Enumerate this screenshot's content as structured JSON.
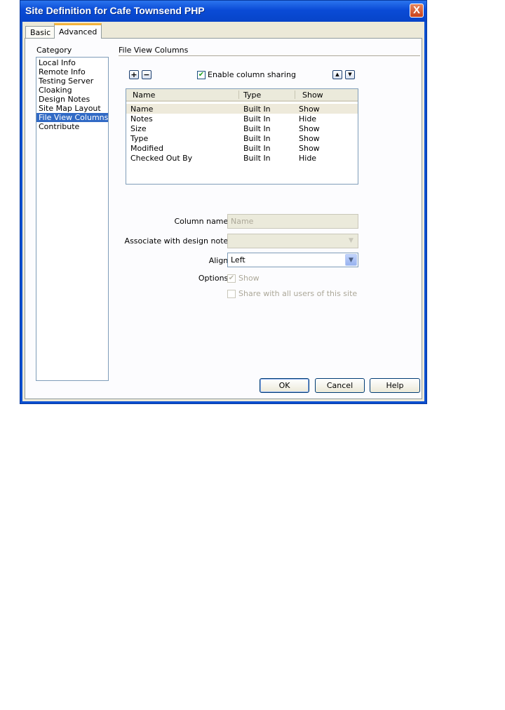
{
  "window": {
    "title": "Site Definition for Cafe Townsend PHP",
    "close_glyph": "X"
  },
  "tabs": [
    {
      "label": "Basic"
    },
    {
      "label": "Advanced",
      "selected": true
    }
  ],
  "category": {
    "label": "Category",
    "items": [
      {
        "label": "Local Info"
      },
      {
        "label": "Remote Info"
      },
      {
        "label": "Testing Server"
      },
      {
        "label": "Cloaking"
      },
      {
        "label": "Design Notes"
      },
      {
        "label": "Site Map Layout"
      },
      {
        "label": "File View Columns",
        "selected": true
      },
      {
        "label": "Contribute"
      }
    ]
  },
  "section": {
    "title": "File View Columns",
    "add_glyph": "+",
    "remove_glyph": "−",
    "enable_sharing": {
      "label": "Enable column sharing",
      "checked": true
    },
    "move_up_glyph": "▲",
    "move_down_glyph": "▼"
  },
  "columns_table": {
    "headers": [
      "Name",
      "Type",
      "Show"
    ],
    "rows": [
      [
        "Name",
        "Built In",
        "Show"
      ],
      [
        "Notes",
        "Built In",
        "Hide"
      ],
      [
        "Size",
        "Built In",
        "Show"
      ],
      [
        "Type",
        "Built In",
        "Show"
      ],
      [
        "Modified",
        "Built In",
        "Show"
      ],
      [
        "Checked Out By",
        "Built In",
        "Hide"
      ]
    ],
    "selected_row": 0
  },
  "form": {
    "column_name_label": "Column name:",
    "column_name_value": "Name",
    "design_note_label": "Associate with design note:",
    "design_note_value": "",
    "align_label": "Align:",
    "align_value": "Left",
    "options_label": "Options:",
    "show_label": "Show",
    "show_checked": true,
    "share_label": "Share with all users of this site",
    "share_checked": false
  },
  "buttons": {
    "ok": "OK",
    "cancel": "Cancel",
    "help": "Help"
  },
  "colors": {
    "titlebar": "#0a4bd6",
    "dialog_bg": "#ece9d8",
    "selection": "#316ac5",
    "accent_tab": "#f4b33b"
  }
}
